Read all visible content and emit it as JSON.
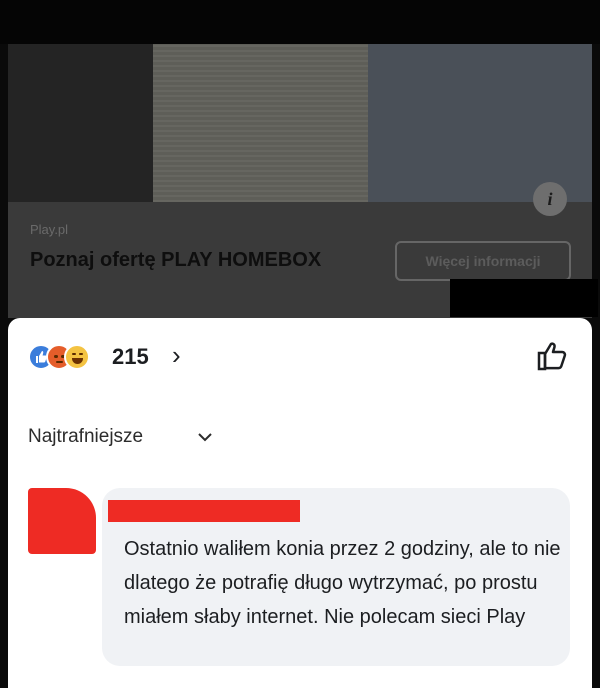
{
  "ad": {
    "source": "Play.pl",
    "title": "Poznaj ofertę PLAY HOMEBOX",
    "button_label": "Więcej informacji",
    "info_icon": "i"
  },
  "post": {
    "reaction_count": "215",
    "reaction_icons": [
      "like-icon",
      "angry-icon",
      "haha-icon"
    ],
    "sort_label": "Najtrafniejsze"
  },
  "comment": {
    "text": "Ostatnio waliłem konia przez 2 godziny, ale to nie dlatego że potrafię długo wytrzymać, po prostu miałem słaby internet. Nie polecam sieci Play"
  },
  "colors": {
    "redaction": "#ee2b24",
    "like": "#3b7ddb",
    "angry": "#e55d2a",
    "haha": "#f4c342"
  }
}
